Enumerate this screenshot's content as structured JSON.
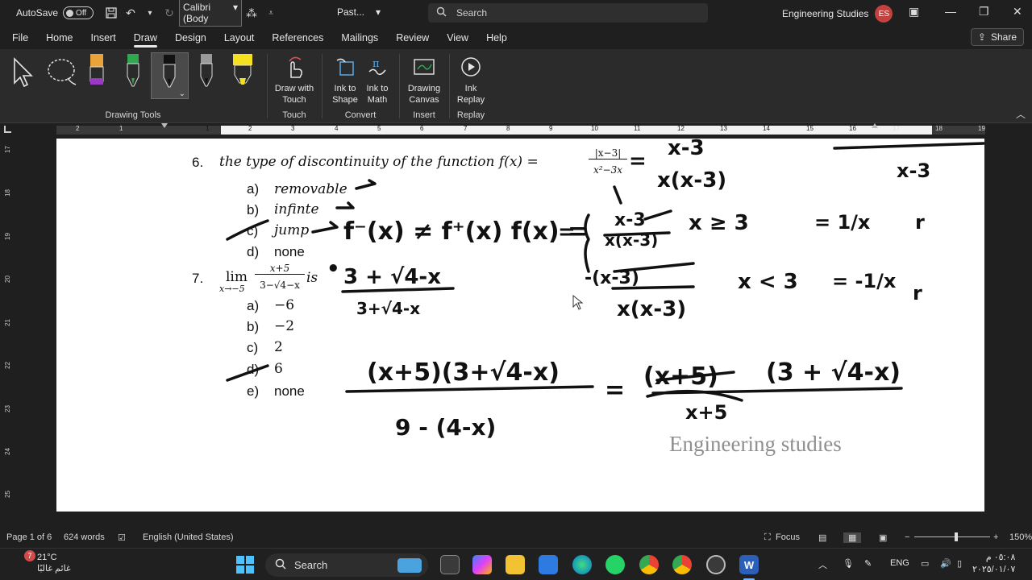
{
  "titlebar": {
    "autosave_label": "AutoSave",
    "autosave_state": "Off",
    "font_name": "Calibri (Body",
    "doc_title": "Past...",
    "search_label": "Search",
    "user_name": "Engineering Studies",
    "user_initials": "ES"
  },
  "menu": {
    "tabs": [
      "File",
      "Home",
      "Insert",
      "Draw",
      "Design",
      "Layout",
      "References",
      "Mailings",
      "Review",
      "View",
      "Help"
    ],
    "active": "Draw",
    "share_label": "Share"
  },
  "ribbon": {
    "groups": {
      "drawing_tools": "Drawing Tools",
      "touch": "Touch",
      "convert": "Convert",
      "insert": "Insert",
      "replay": "Replay"
    },
    "buttons": {
      "draw_with_touch": [
        "Draw with",
        "Touch"
      ],
      "ink_to_shape": [
        "Ink to",
        "Shape"
      ],
      "ink_to_math": [
        "Ink to",
        "Math"
      ],
      "drawing_canvas": [
        "Drawing",
        "Canvas"
      ],
      "ink_replay": [
        "Ink",
        "Replay"
      ]
    },
    "pen_colors": [
      "#e8a33a",
      "#2fa84f",
      "#111111",
      "#9a9a9a",
      "#f5e020"
    ]
  },
  "document": {
    "q6": {
      "number": "6.",
      "text": "the type of discontinuity of the function f(x) =",
      "frac_num": "|x−3|",
      "frac_den": "x²−3x",
      "options": [
        {
          "letter": "a)",
          "text": "removable"
        },
        {
          "letter": "b)",
          "text": "infinte"
        },
        {
          "letter": "c)",
          "text": "jump"
        },
        {
          "letter": "d)",
          "text": "none"
        }
      ]
    },
    "q7": {
      "number": "7.",
      "lim": "lim",
      "lim_sub": "x→−5",
      "frac_num": "x+5",
      "frac_den": "3−√4−x",
      "suffix": "is",
      "options": [
        {
          "letter": "a)",
          "text": "−6"
        },
        {
          "letter": "b)",
          "text": "−2"
        },
        {
          "letter": "c)",
          "text": "2"
        },
        {
          "letter": "d)",
          "text": "6"
        },
        {
          "letter": "e)",
          "text": "none"
        }
      ]
    },
    "watermark": "Engineering studies",
    "ink": {
      "a1": "(x+5)(3+√4-x)",
      "a2": "9 - (4-x)",
      "a3": "(x+5)",
      "a4": "(3 + √4-x)",
      "a5": "x+5",
      "b1": "3 + √4-x",
      "b2": "3+√4-x",
      "c1": "x-3",
      "c2": "x(x-3)",
      "c3": "x ≥ 3",
      "c4": "x < 3",
      "c5": "= 1/x",
      "c6": "= -1/x",
      "c7": "f⁻(x) ≠ f⁺(x) f(x) =",
      "c8": "x-3",
      "c9": "x(x-3)",
      "c10": "-(x-3)",
      "c11": "x(x-3)"
    }
  },
  "ruler": {
    "top": [
      "2",
      "1",
      "1",
      "2",
      "3",
      "4",
      "5",
      "6",
      "7",
      "8",
      "9",
      "10",
      "11",
      "12",
      "13",
      "14",
      "15",
      "16",
      "17",
      "18",
      "19"
    ],
    "left": [
      "17",
      "18",
      "19",
      "20",
      "21",
      "22",
      "23",
      "24",
      "25"
    ]
  },
  "status": {
    "page": "Page 1 of 6",
    "words": "624 words",
    "language": "English (United States)",
    "focus": "Focus",
    "zoom": "150%"
  },
  "taskbar": {
    "temp": "21°C",
    "weather_text": "غائم غالبًا",
    "badge": "7",
    "search_label": "Search",
    "lang": "ENG",
    "time": "٠٥:٠٨ م",
    "date": "٢٠٢٥/٠١/٠٧"
  }
}
